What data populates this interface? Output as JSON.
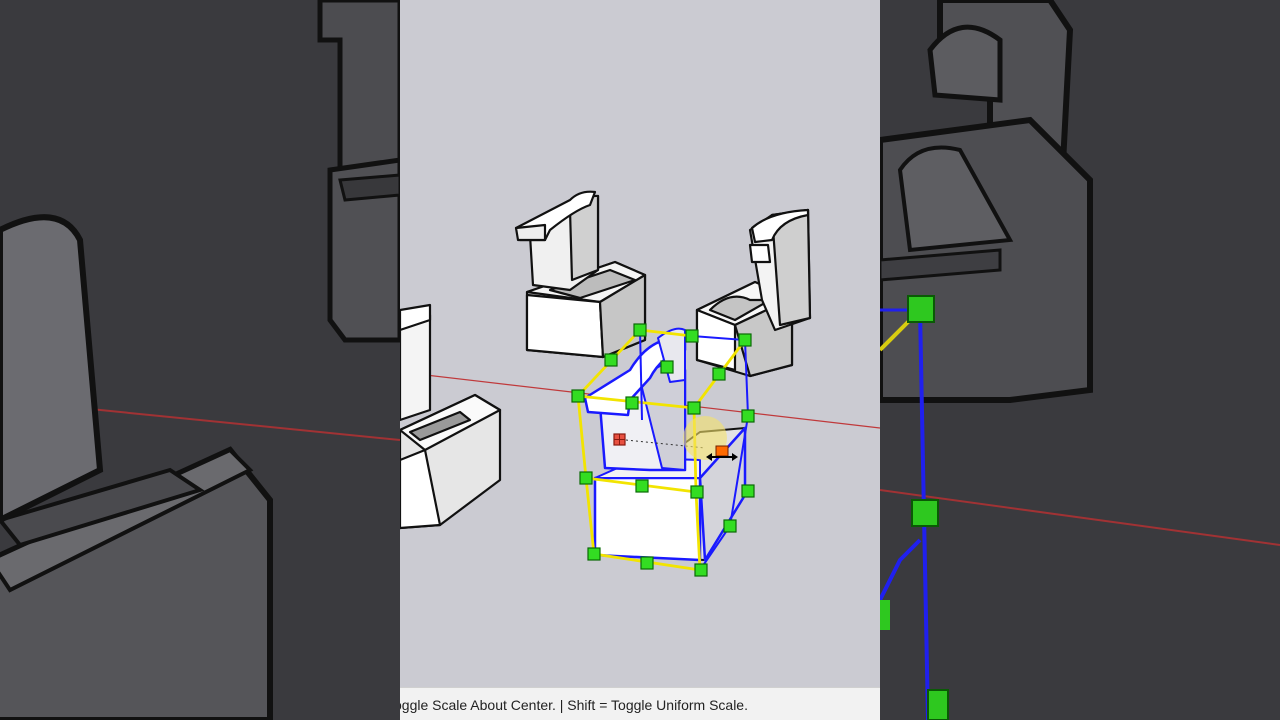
{
  "statusbar": {
    "hint_text": "oggle Scale About Center. | Shift = Toggle Uniform Scale."
  },
  "colors": {
    "viewport_bg": "#cbcbd2",
    "side_bg": "#3c3c40",
    "x_axis": "#c0393b",
    "bbox_yellow": "#f2e400",
    "bbox_blue": "#1a1aff",
    "grip_green": "#33dd22",
    "center_marker": "#d03a2a",
    "cursor_highlight": "#f5e26b"
  },
  "icons": {
    "scale_center": "center-marker-icon",
    "cursor": "scale-cursor-icon",
    "grip": "grip-handle-icon"
  }
}
